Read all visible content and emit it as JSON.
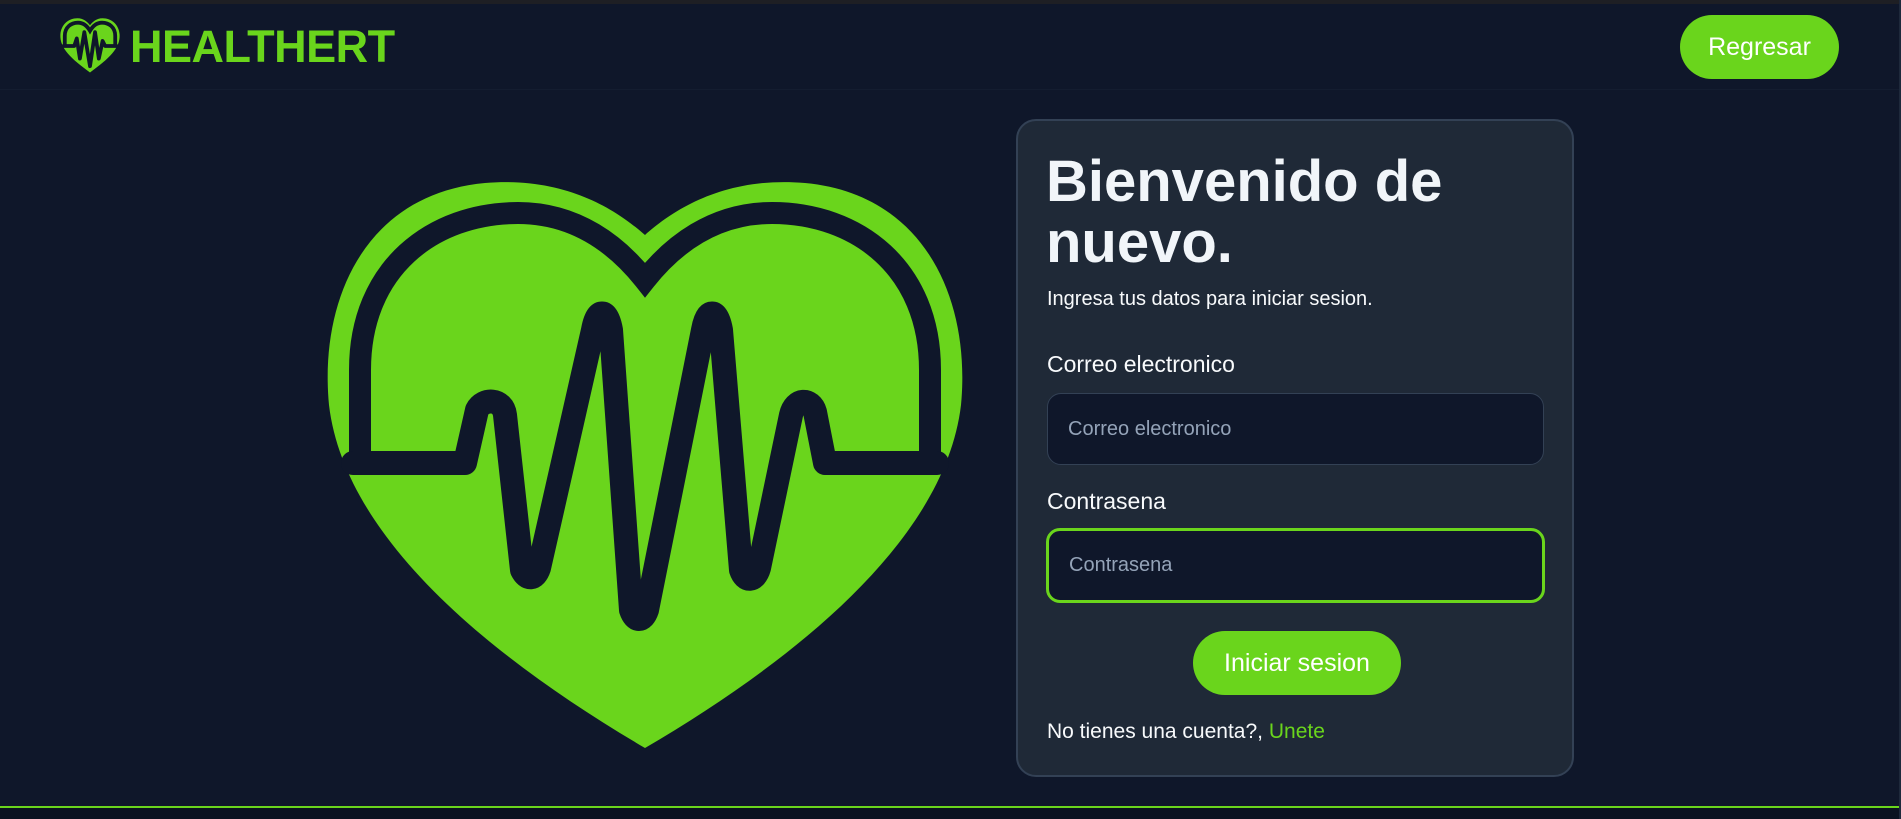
{
  "header": {
    "brand_name": "HEALTHERT",
    "brand_icon": "heart-pulse-icon",
    "back_label": "Regresar"
  },
  "hero": {
    "icon": "heart-pulse-icon"
  },
  "login": {
    "title": "Bienvenido de nuevo.",
    "subtitle": "Ingresa tus datos para iniciar sesion.",
    "email_label": "Correo electronico",
    "email_placeholder": "Correo electronico",
    "email_value": "",
    "password_label": "Contrasena",
    "password_placeholder": "Contrasena",
    "password_value": "",
    "submit_label": "Iniciar sesion",
    "signup_prompt": "No tienes una cuenta?,",
    "signup_link": "Unete"
  },
  "colors": {
    "accent": "#6ad51c",
    "background": "#0f172a",
    "card": "#1f2937"
  }
}
